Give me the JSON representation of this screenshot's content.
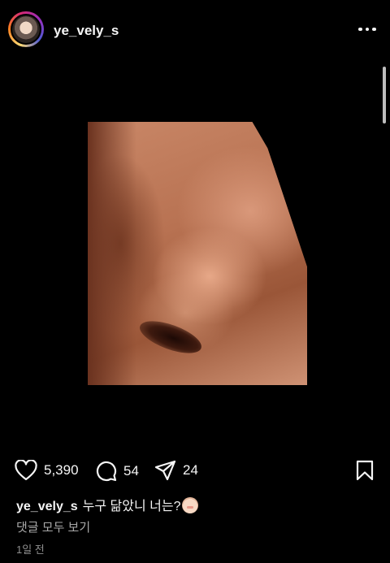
{
  "header": {
    "username": "ye_vely_s"
  },
  "actions": {
    "likes": "5,390",
    "comments": "54",
    "shares": "24"
  },
  "caption": {
    "username": "ye_vely_s",
    "text": "누구 닮았니 너는?"
  },
  "view_comments": "댓글 모두 보기",
  "timestamp": "1일 전",
  "icons": [
    "more-icon",
    "heart-icon",
    "comment-icon",
    "share-icon",
    "bookmark-icon",
    "baby-emoji-icon"
  ]
}
